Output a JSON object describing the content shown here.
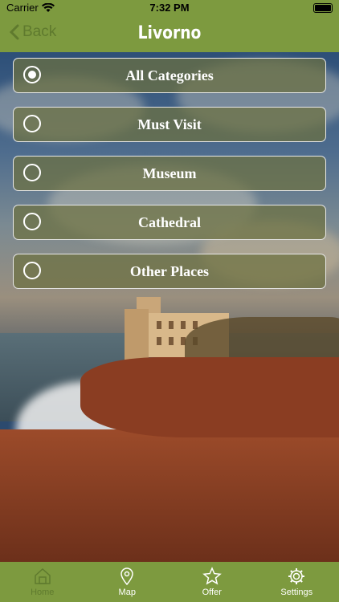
{
  "status_bar": {
    "carrier": "Carrier",
    "time": "7:32 PM"
  },
  "nav": {
    "back_label": "Back",
    "title": "Livorno"
  },
  "categories": [
    {
      "label": "All Categories",
      "selected": true
    },
    {
      "label": "Must Visit",
      "selected": false
    },
    {
      "label": "Museum",
      "selected": false
    },
    {
      "label": "Cathedral",
      "selected": false
    },
    {
      "label": "Other Places",
      "selected": false
    }
  ],
  "tabs": [
    {
      "label": "Home",
      "icon": "home-icon",
      "active": true
    },
    {
      "label": "Map",
      "icon": "map-pin-icon",
      "active": false
    },
    {
      "label": "Offer",
      "icon": "star-icon",
      "active": false
    },
    {
      "label": "Settings",
      "icon": "gear-icon",
      "active": false
    }
  ],
  "colors": {
    "bar": "#7d9a3f",
    "item_bg": "#6c7040",
    "active_tab": "#5f7a2e"
  }
}
